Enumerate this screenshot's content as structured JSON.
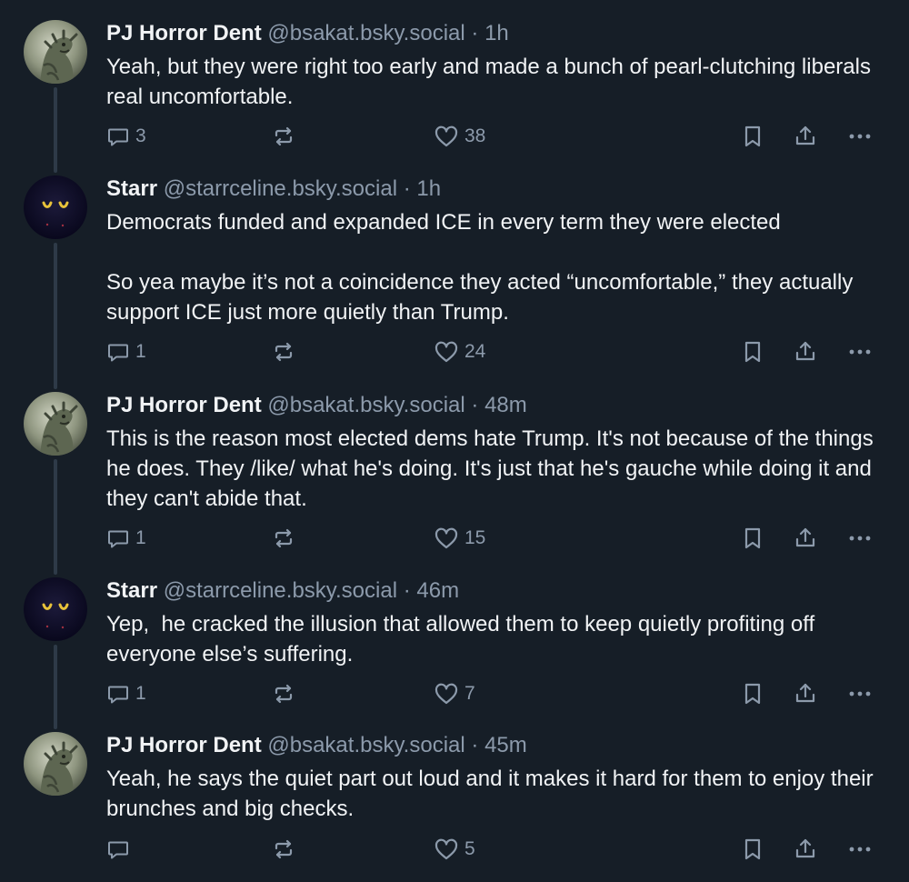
{
  "colors": {
    "background": "#161e27",
    "text": "#f1f3f5",
    "muted": "#8c9aab",
    "thread_line": "#2e3a48"
  },
  "posts": [
    {
      "avatar": "godzilla-avatar",
      "name": "PJ Horror Dent",
      "handle": "@bsakat.bsky.social",
      "time": "1h",
      "text": "Yeah, but they were right too early and made a bunch of pearl-clutching liberals real uncomfortable.",
      "replies": "3",
      "reposts": "",
      "likes": "38"
    },
    {
      "avatar": "dark-creature-avatar",
      "name": "Starr",
      "handle": "@starrceline.bsky.social",
      "time": "1h",
      "text": "Democrats funded and expanded ICE in every term they were elected\n\nSo yea maybe it’s not a coincidence they acted “uncomfortable,” they actually support ICE just more quietly than Trump.",
      "replies": "1",
      "reposts": "",
      "likes": "24"
    },
    {
      "avatar": "godzilla-avatar",
      "name": "PJ Horror Dent",
      "handle": "@bsakat.bsky.social",
      "time": "48m",
      "text": "This is the reason most elected dems hate Trump. It's not because of the things he does. They /like/ what he's doing. It's just that he's gauche while doing it and they can't abide that.",
      "replies": "1",
      "reposts": "",
      "likes": "15"
    },
    {
      "avatar": "dark-creature-avatar",
      "name": "Starr",
      "handle": "@starrceline.bsky.social",
      "time": "46m",
      "text": "Yep,  he cracked the illusion that allowed them to keep quietly profiting off everyone else’s suffering.",
      "replies": "1",
      "reposts": "",
      "likes": "7"
    },
    {
      "avatar": "godzilla-avatar",
      "name": "PJ Horror Dent",
      "handle": "@bsakat.bsky.social",
      "time": "45m",
      "text": "Yeah, he says the quiet part out loud and it makes it hard for them to enjoy their brunches and big checks.",
      "replies": "",
      "reposts": "",
      "likes": "5"
    }
  ]
}
